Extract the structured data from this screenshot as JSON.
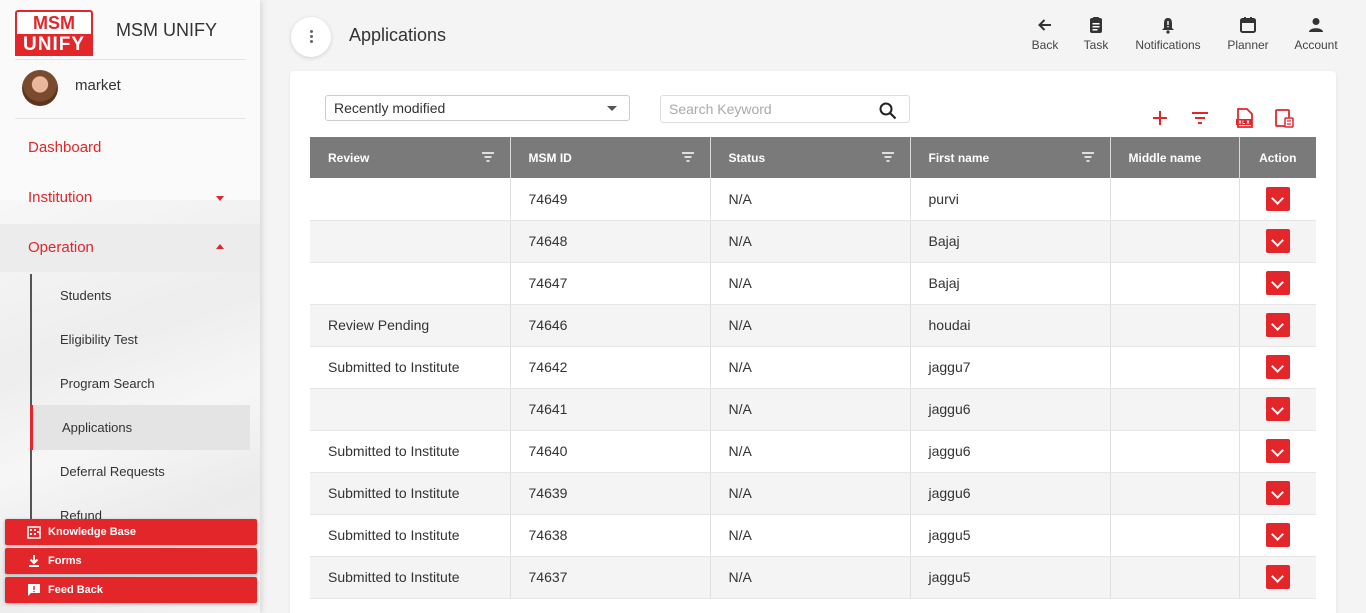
{
  "brand": {
    "logo_top": "MSM",
    "logo_bottom": "UNIFY",
    "name": "MSM UNIFY"
  },
  "user": {
    "name": "market"
  },
  "nav": {
    "dashboard": "Dashboard",
    "institution": "Institution",
    "operation": "Operation",
    "sub_items": [
      "Students",
      "Eligibility Test",
      "Program Search",
      "Applications",
      "Deferral Requests",
      "Refund"
    ]
  },
  "bottom_buttons": {
    "knowledge": "Knowledge Base",
    "forms": "Forms",
    "feedback": "Feed Back"
  },
  "header": {
    "title": "Applications",
    "actions": {
      "back": "Back",
      "task": "Task",
      "notifications": "Notifications",
      "planner": "Planner",
      "account": "Account"
    }
  },
  "toolbar": {
    "sort_value": "Recently modified",
    "search_placeholder": "Search Keyword"
  },
  "table": {
    "columns": [
      "Review",
      "MSM ID",
      "Status",
      "First name",
      "Middle name",
      "Action"
    ],
    "rows": [
      {
        "review": "",
        "id": "74649",
        "status": "N/A",
        "first": "purvi",
        "middle": ""
      },
      {
        "review": "",
        "id": "74648",
        "status": "N/A",
        "first": "Bajaj",
        "middle": ""
      },
      {
        "review": "",
        "id": "74647",
        "status": "N/A",
        "first": "Bajaj",
        "middle": ""
      },
      {
        "review": "Review Pending",
        "id": "74646",
        "status": "N/A",
        "first": "houdai",
        "middle": ""
      },
      {
        "review": "Submitted to Institute",
        "id": "74642",
        "status": "N/A",
        "first": "jaggu7",
        "middle": ""
      },
      {
        "review": "",
        "id": "74641",
        "status": "N/A",
        "first": "jaggu6",
        "middle": ""
      },
      {
        "review": "Submitted to Institute",
        "id": "74640",
        "status": "N/A",
        "first": "jaggu6",
        "middle": ""
      },
      {
        "review": "Submitted to Institute",
        "id": "74639",
        "status": "N/A",
        "first": "jaggu6",
        "middle": ""
      },
      {
        "review": "Submitted to Institute",
        "id": "74638",
        "status": "N/A",
        "first": "jaggu5",
        "middle": ""
      },
      {
        "review": "Submitted to Institute",
        "id": "74637",
        "status": "N/A",
        "first": "jaggu5",
        "middle": ""
      }
    ]
  },
  "colors": {
    "accent": "#e3262a",
    "header_bg": "#7a7a7a"
  }
}
